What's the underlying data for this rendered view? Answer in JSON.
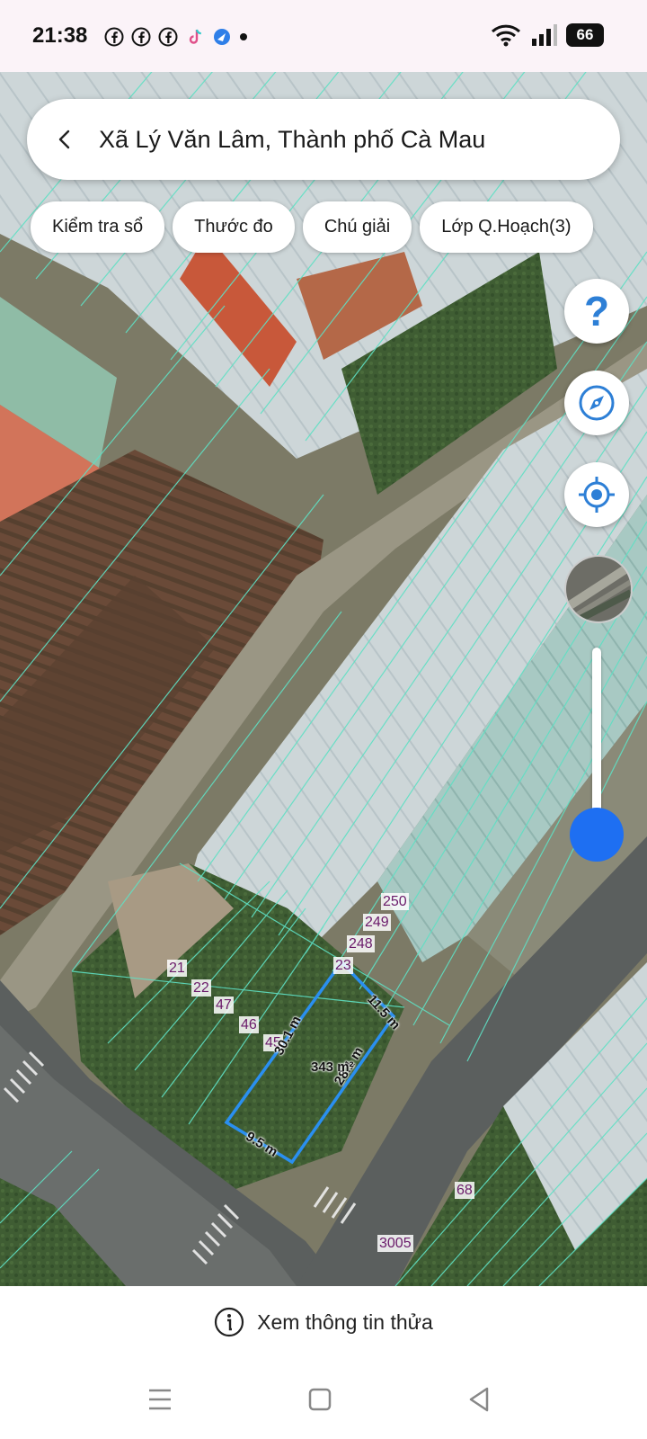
{
  "status_bar": {
    "time": "21:38",
    "app_icons": [
      "facebook-icon",
      "facebook-icon",
      "facebook-icon",
      "tiktok-icon",
      "app-icon",
      "dot-icon"
    ],
    "battery": "66"
  },
  "search": {
    "title": "Xã Lý Văn Lâm, Thành phố Cà Mau"
  },
  "chips": {
    "check_book": "Kiểm tra sổ",
    "ruler": "Thước đo",
    "legend": "Chú giải",
    "planning_layer": "Lớp Q.Hoạch(3)"
  },
  "map": {
    "help_label": "?",
    "zoom_level": 0.1,
    "parcel_labels": [
      "250",
      "249",
      "248",
      "23",
      "21",
      "22",
      "47",
      "46",
      "45",
      "68",
      "3005"
    ],
    "dimensions": {
      "side_top": "11.5 m",
      "side_left": "30.1 m",
      "side_right": "28.1 m",
      "side_bottom": "9.5 m",
      "area": "343 m²"
    },
    "colors": {
      "parcel_outline": "#2a8ff0",
      "grid_lines": "#5fe0c4",
      "accent": "#1e6ff2"
    }
  },
  "bottom": {
    "info_label": "Xem thông tin thửa"
  }
}
